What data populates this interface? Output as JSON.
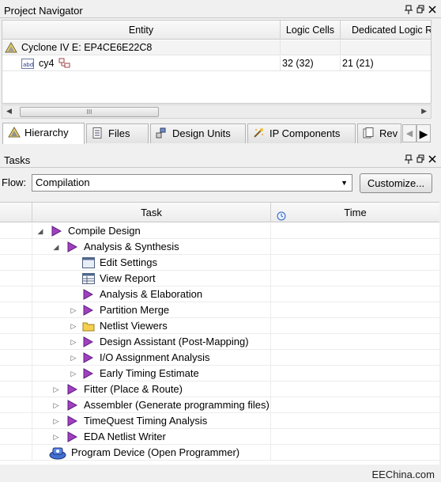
{
  "navigator": {
    "title": "Project Navigator",
    "columns": [
      "Entity",
      "Logic Cells",
      "Dedicated Logic R"
    ],
    "rows": [
      {
        "entity": "Cyclone IV E: EP4CE6E22C8",
        "logic_cells": "",
        "dedicated": "",
        "icon": "warning-device-icon"
      },
      {
        "entity": "cy4",
        "logic_cells": "32 (32)",
        "dedicated": "21 (21)",
        "icon": "abd-entity-icon"
      }
    ],
    "scroll_thumb": "III"
  },
  "tabs": [
    {
      "label": "Hierarchy",
      "icon": "hierarchy-icon",
      "active": true
    },
    {
      "label": "Files",
      "icon": "files-icon"
    },
    {
      "label": "Design Units",
      "icon": "design-units-icon"
    },
    {
      "label": "IP Components",
      "icon": "ip-components-icon"
    },
    {
      "label": "Rev",
      "icon": "revisions-icon"
    }
  ],
  "tasks": {
    "title": "Tasks",
    "flow_label": "Flow:",
    "flow_value": "Compilation",
    "customize_label": "Customize...",
    "columns": {
      "task": "Task",
      "time": "Time"
    },
    "rows": [
      {
        "label": "Compile Design",
        "level": 0,
        "exp": "open",
        "icon": "play"
      },
      {
        "label": "Analysis & Synthesis",
        "level": 1,
        "exp": "open",
        "icon": "play"
      },
      {
        "label": "Edit Settings",
        "level": 2,
        "exp": "none",
        "icon": "settings"
      },
      {
        "label": "View Report",
        "level": 2,
        "exp": "none",
        "icon": "report"
      },
      {
        "label": "Analysis & Elaboration",
        "level": 2,
        "exp": "none",
        "icon": "play"
      },
      {
        "label": "Partition Merge",
        "level": 2,
        "exp": "closed",
        "icon": "play"
      },
      {
        "label": "Netlist Viewers",
        "level": 2,
        "exp": "closed",
        "icon": "folder"
      },
      {
        "label": "Design Assistant (Post-Mapping)",
        "level": 2,
        "exp": "closed",
        "icon": "play"
      },
      {
        "label": "I/O Assignment Analysis",
        "level": 2,
        "exp": "closed",
        "icon": "play"
      },
      {
        "label": "Early Timing Estimate",
        "level": 2,
        "exp": "closed",
        "icon": "play"
      },
      {
        "label": "Fitter (Place & Route)",
        "level": 1,
        "exp": "closed",
        "icon": "play"
      },
      {
        "label": "Assembler (Generate programming files)",
        "level": 1,
        "exp": "closed",
        "icon": "play"
      },
      {
        "label": "TimeQuest Timing Analysis",
        "level": 1,
        "exp": "closed",
        "icon": "play"
      },
      {
        "label": "EDA Netlist Writer",
        "level": 1,
        "exp": "closed",
        "icon": "play"
      },
      {
        "label": "Program Device (Open Programmer)",
        "level": 0,
        "exp": "none",
        "icon": "programmer"
      }
    ]
  },
  "window_controls": [
    "pin",
    "restore",
    "close"
  ],
  "watermark": "EEChina.com"
}
